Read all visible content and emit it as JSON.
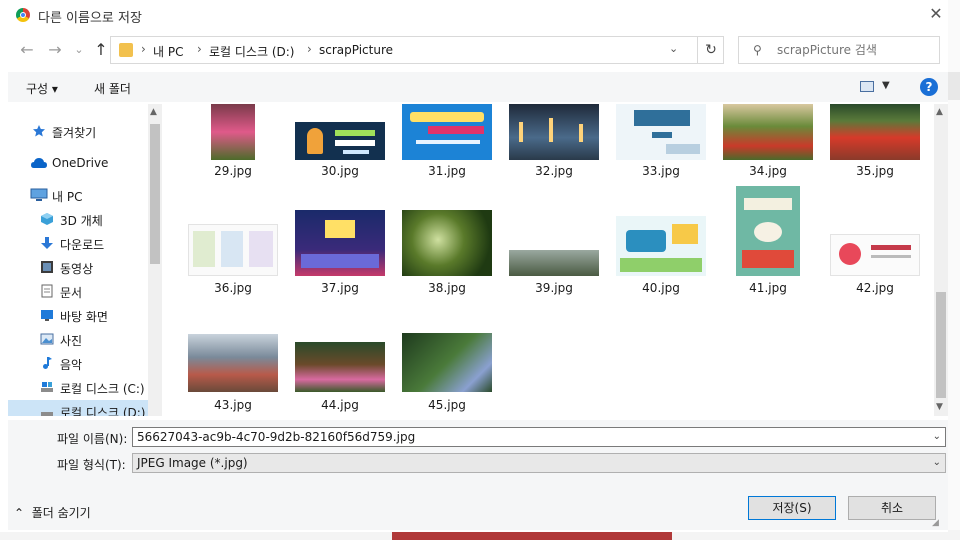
{
  "window": {
    "title": "다른 이름으로 저장"
  },
  "address": {
    "crumbs": [
      "내 PC",
      "로컬 디스크 (D:)",
      "scrapPicture"
    ],
    "separator": "›"
  },
  "search": {
    "placeholder": "scrapPicture 검색"
  },
  "toolbar": {
    "organize": "구성 ▾",
    "new_folder": "새 폴더",
    "help": "?"
  },
  "nav_pane": {
    "items": [
      {
        "label": "즐겨찾기",
        "icon": "star-icon"
      },
      {
        "label": "OneDrive",
        "icon": "cloud-icon"
      },
      {
        "label": "내 PC",
        "icon": "computer-icon"
      },
      {
        "label": "3D 개체",
        "icon": "cube-icon"
      },
      {
        "label": "다운로드",
        "icon": "download-arrow-icon"
      },
      {
        "label": "동영상",
        "icon": "film-icon"
      },
      {
        "label": "문서",
        "icon": "document-icon"
      },
      {
        "label": "바탕 화면",
        "icon": "desktop-icon"
      },
      {
        "label": "사진",
        "icon": "picture-icon"
      },
      {
        "label": "음악",
        "icon": "music-note-icon"
      },
      {
        "label": "로컬 디스크 (C:)",
        "icon": "drive-icon"
      },
      {
        "label": "로컬 디스크 (D:)",
        "icon": "drive-icon"
      }
    ]
  },
  "files": [
    {
      "name": "29.jpg"
    },
    {
      "name": "30.jpg"
    },
    {
      "name": "31.jpg"
    },
    {
      "name": "32.jpg"
    },
    {
      "name": "33.jpg"
    },
    {
      "name": "34.jpg"
    },
    {
      "name": "35.jpg"
    },
    {
      "name": "36.jpg"
    },
    {
      "name": "37.jpg"
    },
    {
      "name": "38.jpg"
    },
    {
      "name": "39.jpg"
    },
    {
      "name": "40.jpg"
    },
    {
      "name": "41.jpg"
    },
    {
      "name": "42.jpg"
    },
    {
      "name": "43.jpg"
    },
    {
      "name": "44.jpg"
    },
    {
      "name": "45.jpg"
    }
  ],
  "fields": {
    "filename_label": "파일 이름(N):",
    "filename_value": "56627043-ac9b-4c70-9d2b-82160f56d759.jpg",
    "filetype_label": "파일 형식(T):",
    "filetype_value": "JPEG Image (*.jpg)"
  },
  "footer": {
    "hide_folders": "폴더 숨기기",
    "save": "저장(S)",
    "cancel": "취소"
  },
  "colors": {
    "accent": "#0078d7",
    "selected": "#cce4f7",
    "orange_strip": "#f28c2e"
  }
}
